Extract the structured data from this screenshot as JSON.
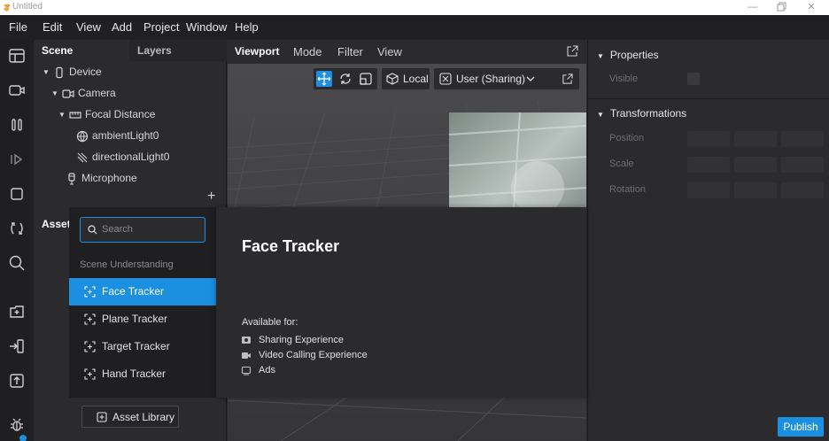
{
  "window": {
    "title": "Untitled"
  },
  "menu": [
    "File",
    "Edit",
    "View",
    "Add",
    "Project",
    "Window",
    "Help"
  ],
  "scene_panel": {
    "tabs": [
      "Scene",
      "Layers"
    ],
    "tree": [
      {
        "label": "Device"
      },
      {
        "label": "Camera"
      },
      {
        "label": "Focal Distance"
      },
      {
        "label": "ambientLight0"
      },
      {
        "label": "directionalLight0"
      },
      {
        "label": "Microphone"
      }
    ],
    "add_symbol": "+"
  },
  "assets_panel": {
    "title": "Assets",
    "asset_library_label": "Asset Library"
  },
  "viewport": {
    "tabs": [
      "Viewport",
      "Mode",
      "Filter",
      "View"
    ],
    "local_label": "Local",
    "user_label": "User (Sharing)"
  },
  "properties": {
    "properties_title": "Properties",
    "visible_label": "Visible",
    "transformations_title": "Transformations",
    "rows": [
      "Position",
      "Scale",
      "Rotation"
    ]
  },
  "popup": {
    "search_placeholder": "Search",
    "category": "Scene Understanding",
    "items": [
      "Face Tracker",
      "Plane Tracker",
      "Target Tracker",
      "Hand Tracker"
    ],
    "selected_index": 0,
    "detail_title": "Face Tracker",
    "available_for_label": "Available for:",
    "available": [
      "Sharing Experience",
      "Video Calling Experience",
      "Ads"
    ]
  },
  "publish_label": "Publish",
  "colors": {
    "accent": "#1b8fe0",
    "background": "#2b2b2e",
    "menubar": "#202022"
  }
}
